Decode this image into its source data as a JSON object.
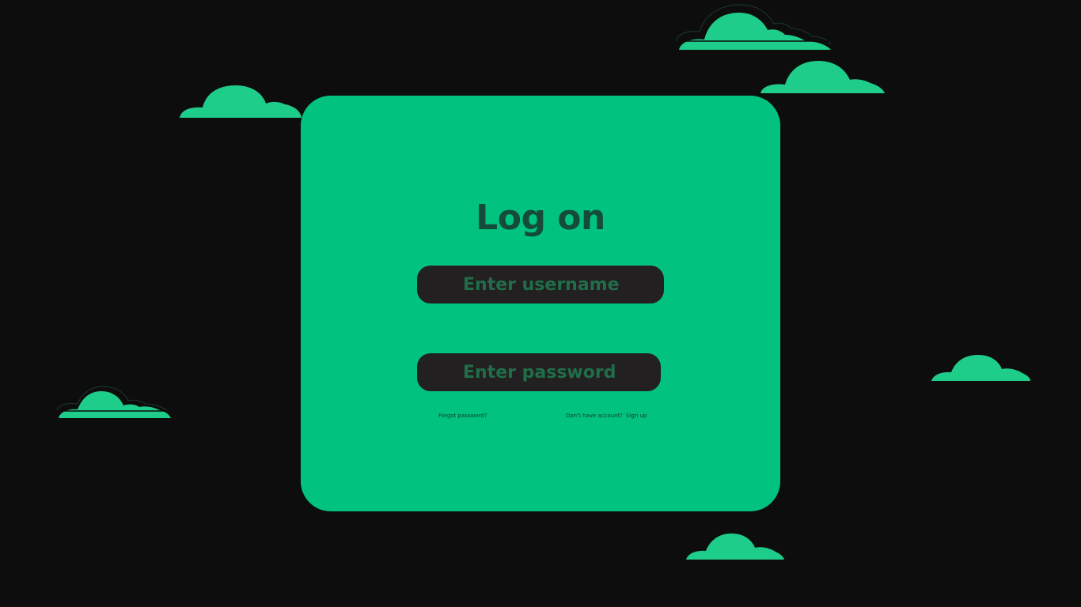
{
  "login": {
    "title": "Log on",
    "username_placeholder": "Enter username",
    "password_placeholder": "Enter password",
    "forgot_password_label": "Forgot password?",
    "no_account_text": "Don't have account?",
    "sign_up_label": "Sign up"
  },
  "theme": {
    "background": "#0d0d0d",
    "card": "#01c37f",
    "cloud": "#1fcd8b",
    "input_background": "#232021",
    "title_text": "#144b3b",
    "placeholder_text": "#1f6e49"
  }
}
